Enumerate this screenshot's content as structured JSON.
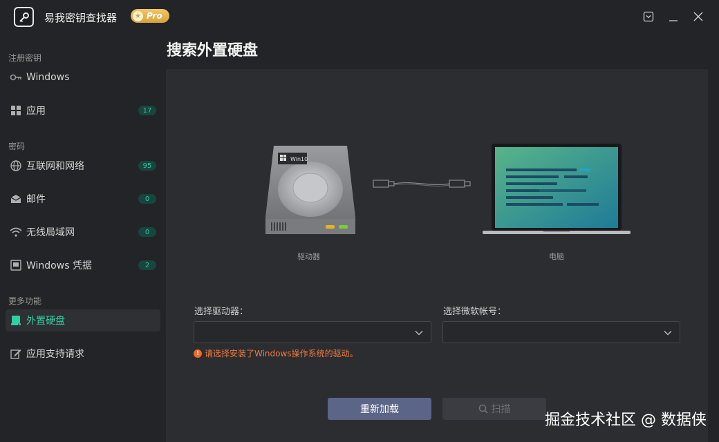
{
  "window": {
    "title": "易我密钥查找器",
    "badge": "Pro"
  },
  "sidebar": {
    "sections": [
      {
        "label": "注册密钥"
      },
      {
        "label": "密码"
      },
      {
        "label": "更多功能"
      }
    ],
    "items": [
      {
        "label": "Windows",
        "icon": "key-icon"
      },
      {
        "label": "应用",
        "count": "17",
        "icon": "apps-grid-icon"
      },
      {
        "label": "互联网和网络",
        "count": "95",
        "icon": "globe-icon"
      },
      {
        "label": "邮件",
        "count": "0",
        "icon": "mail-icon"
      },
      {
        "label": "无线局域网",
        "count": "0",
        "icon": "wifi-icon"
      },
      {
        "label": "Windows 凭据",
        "count": "2",
        "icon": "monitor-icon"
      },
      {
        "label": "外置硬盘",
        "icon": "external-drive-icon",
        "active": true
      },
      {
        "label": "应用支持请求",
        "icon": "edit-icon"
      }
    ]
  },
  "main": {
    "title": "搜索外置硬盘",
    "drive_caption": "驱动器",
    "drive_badge": "Win10",
    "pc_caption": "电脑",
    "drive_select_label": "选择驱动器：",
    "account_select_label": "选择微软帐号：",
    "warning": "请选择安装了Windows操作系统的驱动。",
    "reload_button": "重新加载",
    "scan_button": "扫描"
  },
  "watermark": "掘金技术社区 @ 数据侠",
  "colors": {
    "accent": "#2ed0a4",
    "primary_button": "#5b6588",
    "warning": "#f07a3a"
  }
}
